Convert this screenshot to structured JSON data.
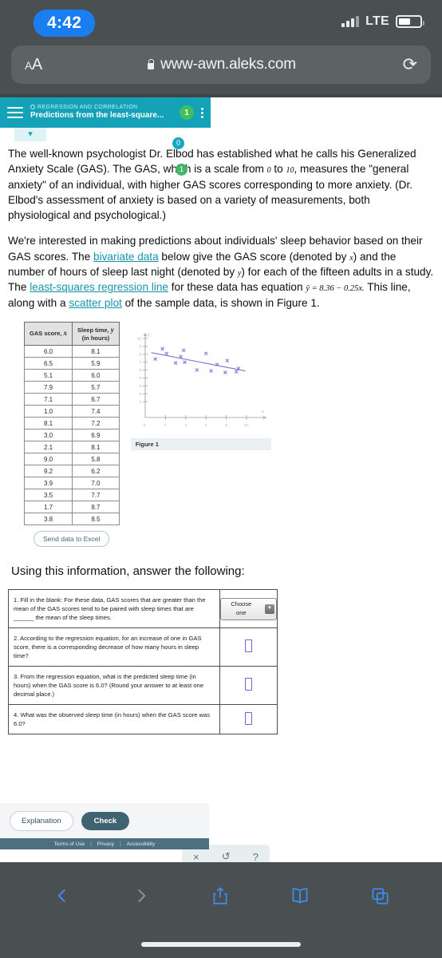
{
  "status": {
    "time": "4:42",
    "network": "LTE",
    "signal_icon": "signal-bars-icon",
    "battery_icon": "battery-icon"
  },
  "browser": {
    "text_size_small": "A",
    "text_size_large": "A",
    "lock_icon": "lock-icon",
    "url": "www-awn.aleks.com",
    "reload_icon": "reload-icon",
    "toolbar": {
      "back_icon": "chevron-left-icon",
      "forward_icon": "chevron-right-icon",
      "share_icon": "share-icon",
      "bookmarks_icon": "book-icon",
      "tabs_icon": "tabs-icon"
    }
  },
  "aleks_header": {
    "menu_icon": "hamburger-menu-icon",
    "section_circle_icon": "circle-outline-icon",
    "section": "REGRESSION AND CORRELATION",
    "title": "Predictions from the least-square...",
    "progress_badge": "1",
    "more_icon": "kebab-menu-icon",
    "collapse_icon": "chevron-down-icon",
    "accent_color": "#14a2b8",
    "badge_color": "#3fbf5f"
  },
  "floating_badges": {
    "teal": "0",
    "green": "1",
    "teal_color": "#17a8bf",
    "green_color": "#45b56a"
  },
  "problem": {
    "paragraph1_a": "The well-known psychologist Dr. Elbod has established what he calls his Generalized Anxiety Scale (GAS). The GAS, which is a scale from ",
    "scale_min": "0",
    "paragraph1_b": " to ",
    "scale_max": "10",
    "paragraph1_c": ", measures the \"general anxiety\" of an individual, with higher GAS scores corresponding to more anxiety. (Dr. Elbod's assessment of anxiety is based on a variety of measurements, both physiological and psychological.)",
    "paragraph2_a": "We're interested in making predictions about individuals' sleep behavior based on their GAS scores. The ",
    "link_bivariate": "bivariate data",
    "paragraph2_b": " below give the GAS score (denoted by ",
    "var_x": "x",
    "paragraph2_c": ") and the number of hours of sleep last night (denoted by ",
    "var_y": "y",
    "paragraph2_d": ") for each of the fifteen adults in a study. The ",
    "link_lsrl": "least-squares regression line",
    "paragraph2_e": " for these data has equation ",
    "equation": "ŷ = 8.36 − 0.25x.",
    "paragraph2_f": " This line, along with a ",
    "link_scatter": "scatter plot",
    "paragraph2_g": " of the sample data, is shown in Figure 1."
  },
  "table": {
    "headers": [
      "GAS score, x",
      "Sleep time, y (in hours)"
    ],
    "header1_text": "GAS score, ",
    "header1_var": "x",
    "header2_line1": "Sleep time, ",
    "header2_var": "y",
    "header2_line2": "(in hours)",
    "rows": [
      [
        "6.0",
        "8.1"
      ],
      [
        "6.5",
        "5.9"
      ],
      [
        "5.1",
        "6.0"
      ],
      [
        "7.9",
        "5.7"
      ],
      [
        "7.1",
        "6.7"
      ],
      [
        "1.0",
        "7.4"
      ],
      [
        "8.1",
        "7.2"
      ],
      [
        "3.0",
        "6.9"
      ],
      [
        "2.1",
        "8.1"
      ],
      [
        "9.0",
        "5.8"
      ],
      [
        "9.2",
        "6.2"
      ],
      [
        "3.9",
        "7.0"
      ],
      [
        "3.5",
        "7.7"
      ],
      [
        "1.7",
        "8.7"
      ],
      [
        "3.8",
        "8.5"
      ]
    ],
    "excel_button": "Send data to Excel"
  },
  "chart_data": {
    "type": "scatter",
    "title": "Figure 1",
    "xlabel": "x",
    "ylabel": "y",
    "xlim": [
      0,
      11.5
    ],
    "ylim": [
      0,
      10.5
    ],
    "xticks": [
      0,
      2,
      4,
      6,
      8,
      10
    ],
    "yticks": [
      2,
      3,
      4,
      5,
      6,
      7,
      8,
      9,
      10
    ],
    "ytick_labels": [
      "2",
      "3",
      "4",
      "5",
      "6",
      "7",
      "8",
      "9",
      "10"
    ],
    "grid": false,
    "legend": null,
    "marker_color": "#7b79d6",
    "line_color": "#7b79d6",
    "points": [
      {
        "x": 6.0,
        "y": 8.1
      },
      {
        "x": 6.5,
        "y": 5.9
      },
      {
        "x": 5.1,
        "y": 6.0
      },
      {
        "x": 7.9,
        "y": 5.7
      },
      {
        "x": 7.1,
        "y": 6.7
      },
      {
        "x": 1.0,
        "y": 7.4
      },
      {
        "x": 8.1,
        "y": 7.2
      },
      {
        "x": 3.0,
        "y": 6.9
      },
      {
        "x": 2.1,
        "y": 8.1
      },
      {
        "x": 9.0,
        "y": 5.8
      },
      {
        "x": 9.2,
        "y": 6.2
      },
      {
        "x": 3.9,
        "y": 7.0
      },
      {
        "x": 3.5,
        "y": 7.7
      },
      {
        "x": 1.7,
        "y": 8.7
      },
      {
        "x": 3.8,
        "y": 8.5
      }
    ],
    "regression_line": {
      "equation": "y = 8.36 - 0.25x",
      "intercept": 8.36,
      "slope": -0.25,
      "x_start": 0.6,
      "x_end": 9.9
    }
  },
  "instruction": "Using this information, answer the following:",
  "questions": [
    {
      "text": "1. Fill in the blank: For these data, GAS scores that are greater than the mean of the GAS scores tend to be paired with sleep times that are ______ the mean of the sleep times.",
      "answer_type": "select",
      "answer_value": "Choose one",
      "dropdown_icon": "chevron-down-icon"
    },
    {
      "text": "2. According to the regression equation, for an increase of one in GAS score, there is a corresponding decrease of how many hours in sleep time?",
      "answer_type": "input",
      "answer_value": ""
    },
    {
      "text": "3. From the regression equation, what is the predicted sleep time (in hours) when the GAS score is 6.0? (Round your answer to at least one decimal place.)",
      "answer_type": "input",
      "answer_value": ""
    },
    {
      "text": "4. What was the observed sleep time (in hours) when the GAS score was 6.0?",
      "answer_type": "input",
      "answer_value": ""
    }
  ],
  "tool_palette": {
    "clear_icon": "×",
    "undo_icon": "↺",
    "help_icon": "?"
  },
  "footer": {
    "explanation_button": "Explanation",
    "check_button": "Check",
    "terms": "Terms of Use",
    "privacy": "Privacy",
    "accessibility": "Accessibility",
    "sep1": "|",
    "sep2": "|"
  }
}
